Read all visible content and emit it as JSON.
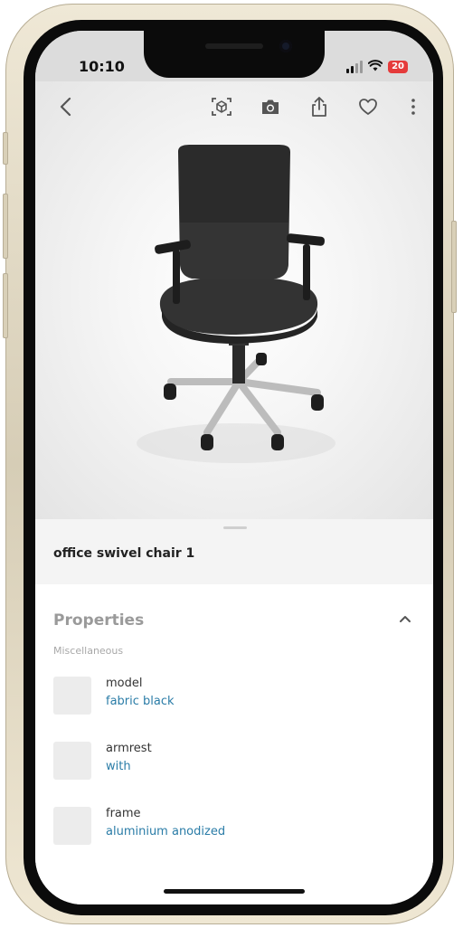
{
  "status_bar": {
    "time": "10:10",
    "battery": "20"
  },
  "toolbar": {
    "icons": [
      "back-chevron-icon",
      "ar-view-icon",
      "camera-icon",
      "share-icon",
      "favorite-heart-icon",
      "more-options-icon"
    ]
  },
  "product": {
    "title": "office swivel chair 1"
  },
  "properties": {
    "title": "Properties",
    "group": "Miscellaneous",
    "items": [
      {
        "label": "model",
        "value": "fabric black"
      },
      {
        "label": "armrest",
        "value": "with"
      },
      {
        "label": "frame",
        "value": "aluminium anodized"
      }
    ]
  },
  "colors": {
    "accent_link": "#2a7ca7",
    "battery_low": "#e53b3b"
  }
}
